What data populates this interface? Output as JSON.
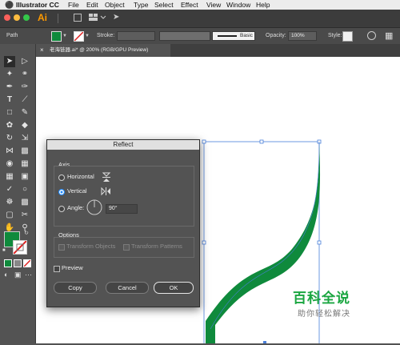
{
  "menubar": {
    "apple": "",
    "app_name": "Illustrator CC",
    "items": [
      "File",
      "Edit",
      "Object",
      "Type",
      "Select",
      "Effect",
      "View",
      "Window",
      "Help"
    ]
  },
  "appbar": {
    "logo": "Ai"
  },
  "control_bar": {
    "selection_type": "Path",
    "fill_color": "#0f8a3c",
    "stroke_label": "Stroke:",
    "brush_label": "Basic",
    "opacity_label": "Opacity:",
    "opacity_value": "100%",
    "style_label": "Style:"
  },
  "document_tab": {
    "title": "老海链器.ai* @ 200% (RGB/GPU Preview)",
    "close": "×"
  },
  "toolbar": {
    "fill_color": "#0f8a3c"
  },
  "dialog": {
    "title": "Reflect",
    "axis_label": "Axis",
    "horizontal_label": "Horizontal",
    "vertical_label": "Vertical",
    "selected_axis": "Vertical",
    "angle_label": "Angle:",
    "angle_value": "90°",
    "options_label": "Options",
    "transform_objects_label": "Transform Objects",
    "transform_patterns_label": "Transform Patterns",
    "preview_label": "Preview",
    "copy_label": "Copy",
    "cancel_label": "Cancel",
    "ok_label": "OK"
  },
  "artwork": {
    "stroke_color": "#0f8a3c",
    "selection_color": "#4a7fd9"
  },
  "watermark": {
    "title": "百科全说",
    "subtitle": "助你轻松解决"
  }
}
